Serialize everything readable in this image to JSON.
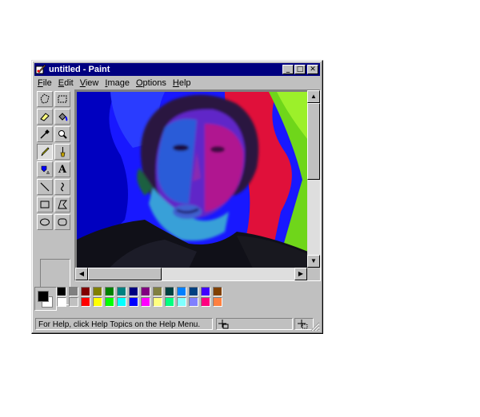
{
  "window": {
    "title": "untitled - Paint"
  },
  "title_buttons": {
    "minimize": "_",
    "maximize": "□",
    "close": "✕"
  },
  "menu": [
    "File",
    "Edit",
    "View",
    "Image",
    "Options",
    "Help"
  ],
  "tools": [
    "free-form-select",
    "select",
    "eraser",
    "fill-with-color",
    "pick-color",
    "magnifier",
    "pencil",
    "brush",
    "airbrush",
    "text",
    "line",
    "curve",
    "rectangle",
    "polygon",
    "ellipse",
    "rounded-rectangle"
  ],
  "active_tool": "pencil",
  "text_tool_glyph": "A",
  "palette": {
    "foreground": "#000000",
    "background": "#ffffff",
    "row1": [
      "#000000",
      "#808080",
      "#800000",
      "#808000",
      "#008000",
      "#008080",
      "#000080",
      "#800080",
      "#808040",
      "#004040",
      "#0080ff",
      "#004080",
      "#4000ff",
      "#804000"
    ],
    "row2": [
      "#ffffff",
      "#c0c0c0",
      "#ff0000",
      "#ffff00",
      "#00ff00",
      "#00ffff",
      "#0000ff",
      "#ff00ff",
      "#ffff80",
      "#00ff80",
      "#80ffff",
      "#8080ff",
      "#ff0080",
      "#ff8040"
    ]
  },
  "status": {
    "message": "For Help, click Help Topics on the Help Menu."
  }
}
